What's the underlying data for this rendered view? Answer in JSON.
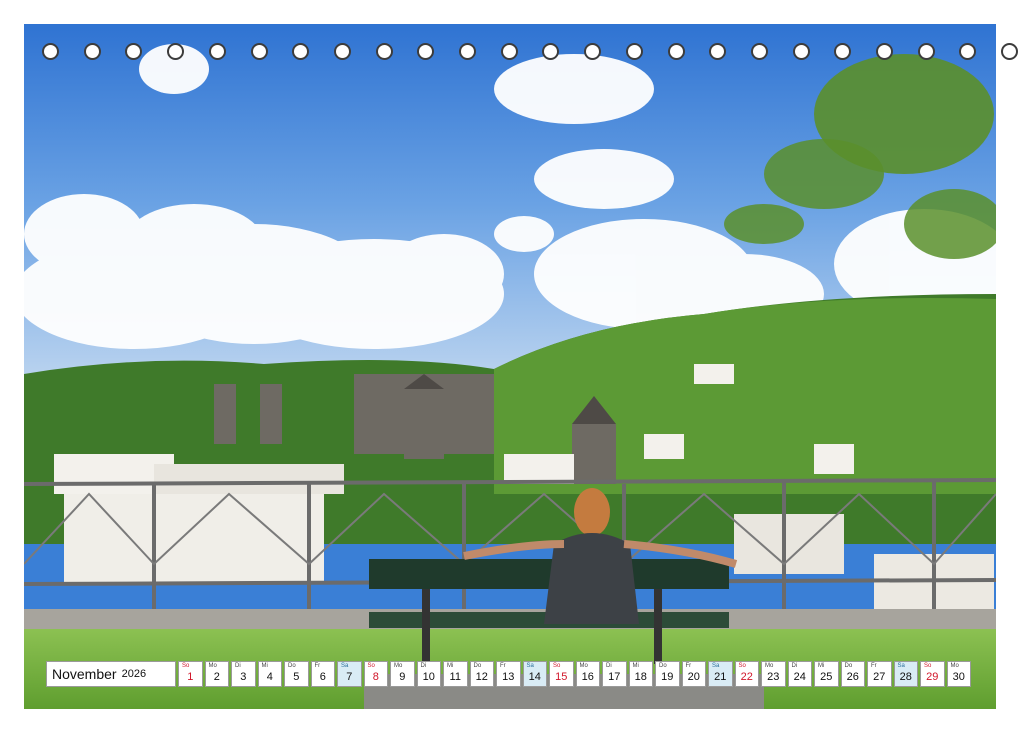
{
  "calendar": {
    "month": "November",
    "year": "2026",
    "days": [
      {
        "wd": "So",
        "dn": "1",
        "kind": "sun"
      },
      {
        "wd": "Mo",
        "dn": "2",
        "kind": ""
      },
      {
        "wd": "Di",
        "dn": "3",
        "kind": ""
      },
      {
        "wd": "Mi",
        "dn": "4",
        "kind": ""
      },
      {
        "wd": "Do",
        "dn": "5",
        "kind": ""
      },
      {
        "wd": "Fr",
        "dn": "6",
        "kind": ""
      },
      {
        "wd": "Sa",
        "dn": "7",
        "kind": "sat"
      },
      {
        "wd": "So",
        "dn": "8",
        "kind": "sun"
      },
      {
        "wd": "Mo",
        "dn": "9",
        "kind": ""
      },
      {
        "wd": "Di",
        "dn": "10",
        "kind": ""
      },
      {
        "wd": "Mi",
        "dn": "11",
        "kind": ""
      },
      {
        "wd": "Do",
        "dn": "12",
        "kind": ""
      },
      {
        "wd": "Fr",
        "dn": "13",
        "kind": ""
      },
      {
        "wd": "Sa",
        "dn": "14",
        "kind": "sat"
      },
      {
        "wd": "So",
        "dn": "15",
        "kind": "sun"
      },
      {
        "wd": "Mo",
        "dn": "16",
        "kind": ""
      },
      {
        "wd": "Di",
        "dn": "17",
        "kind": ""
      },
      {
        "wd": "Mi",
        "dn": "18",
        "kind": ""
      },
      {
        "wd": "Do",
        "dn": "19",
        "kind": ""
      },
      {
        "wd": "Fr",
        "dn": "20",
        "kind": ""
      },
      {
        "wd": "Sa",
        "dn": "21",
        "kind": "sat"
      },
      {
        "wd": "So",
        "dn": "22",
        "kind": "sun"
      },
      {
        "wd": "Mo",
        "dn": "23",
        "kind": ""
      },
      {
        "wd": "Di",
        "dn": "24",
        "kind": ""
      },
      {
        "wd": "Mi",
        "dn": "25",
        "kind": ""
      },
      {
        "wd": "Do",
        "dn": "26",
        "kind": ""
      },
      {
        "wd": "Fr",
        "dn": "27",
        "kind": ""
      },
      {
        "wd": "Sa",
        "dn": "28",
        "kind": "sat"
      },
      {
        "wd": "So",
        "dn": "29",
        "kind": "sun"
      },
      {
        "wd": "Mo",
        "dn": "30",
        "kind": ""
      }
    ]
  },
  "binding_holes": 24,
  "colors": {
    "sunday": "#d1162a",
    "saturday_bg": "#d9ecf5",
    "sky": "#3a7fd6",
    "grass": "#7cb342"
  }
}
